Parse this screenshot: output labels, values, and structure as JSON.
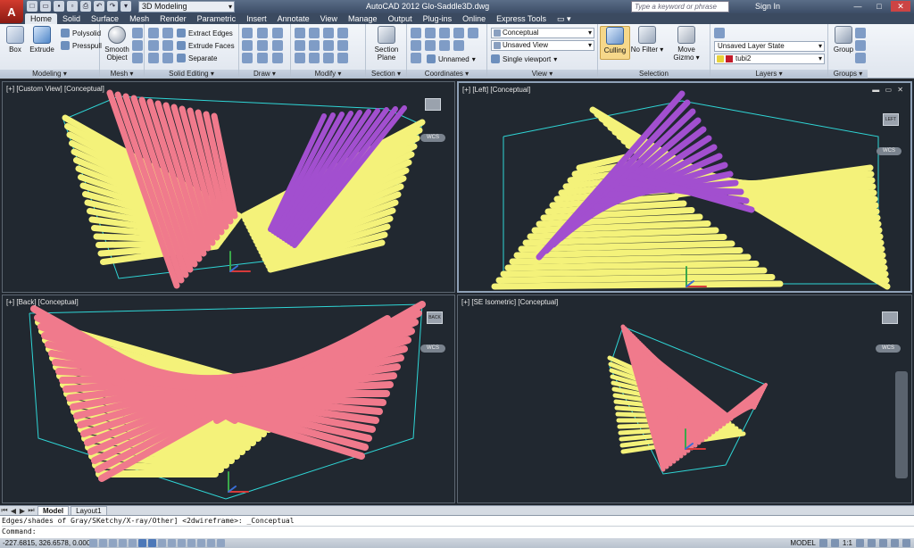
{
  "app": {
    "title": "AutoCAD 2012    Glo-Saddle3D.dwg",
    "logo": "A",
    "workspace": "3D Modeling",
    "search_placeholder": "Type a keyword or phrase",
    "sign_in": "Sign In"
  },
  "tabs": [
    "Home",
    "Solid",
    "Surface",
    "Mesh",
    "Render",
    "Parametric",
    "Insert",
    "Annotate",
    "View",
    "Manage",
    "Output",
    "Plug-ins",
    "Online",
    "Express Tools"
  ],
  "ribbon": {
    "modeling": {
      "title": "Modeling",
      "box": "Box",
      "extrude": "Extrude",
      "polysolid": "Polysolid",
      "presspull": "Presspull"
    },
    "mesh": {
      "title": "Mesh",
      "smooth_object": "Smooth Object"
    },
    "solid_editing": {
      "title": "Solid Editing",
      "extract_edges": "Extract Edges",
      "extrude_faces": "Extrude Faces",
      "separate": "Separate"
    },
    "draw": {
      "title": "Draw"
    },
    "modify": {
      "title": "Modify"
    },
    "section": {
      "title": "Section",
      "section_plane": "Section Plane"
    },
    "coordinates": {
      "title": "Coordinates",
      "unnamed": "Unnamed"
    },
    "view": {
      "title": "View",
      "visual_style": "Conceptual",
      "named_view": "Unsaved View",
      "viewport_config": "Single viewport"
    },
    "selection": {
      "title": "Selection",
      "culling": "Culling",
      "no_filter": "No Filter",
      "move_gizmo": "Move Gizmo"
    },
    "layers": {
      "title": "Layers",
      "layer_state": "Unsaved Layer State",
      "current_layer": "tubi2"
    },
    "groups": {
      "title": "Groups",
      "group": "Group"
    }
  },
  "viewports": {
    "top_left": {
      "label": "[+] [Custom View] [Conceptual]",
      "wcs": "WCS"
    },
    "top_right": {
      "label": "[+] [Left] [Conceptual]",
      "wcs": "WCS",
      "cube": "LEFT"
    },
    "bottom_left": {
      "label": "[+] [Back] [Conceptual]",
      "wcs": "WCS",
      "cube": "BACK"
    },
    "bottom_right": {
      "label": "[+] [SE Isometric] [Conceptual]",
      "wcs": "WCS"
    }
  },
  "layout_tabs": [
    "Model",
    "Layout1"
  ],
  "command": {
    "history": "Edges/shades of Gray/SKetchy/X-ray/Other] <2dwireframe>: _Conceptual",
    "prompt": "Command:"
  },
  "status": {
    "coordinates": "-227.6815, 326.6578, 0.0000",
    "model": "MODEL",
    "scale": "1:1"
  },
  "colors": {
    "tube_yellow": "#f4f27a",
    "tube_pink": "#f07a8c",
    "tube_purple": "#a24fcf",
    "edge_cyan": "#2fd6d6",
    "viewport_bg": "#212830"
  }
}
